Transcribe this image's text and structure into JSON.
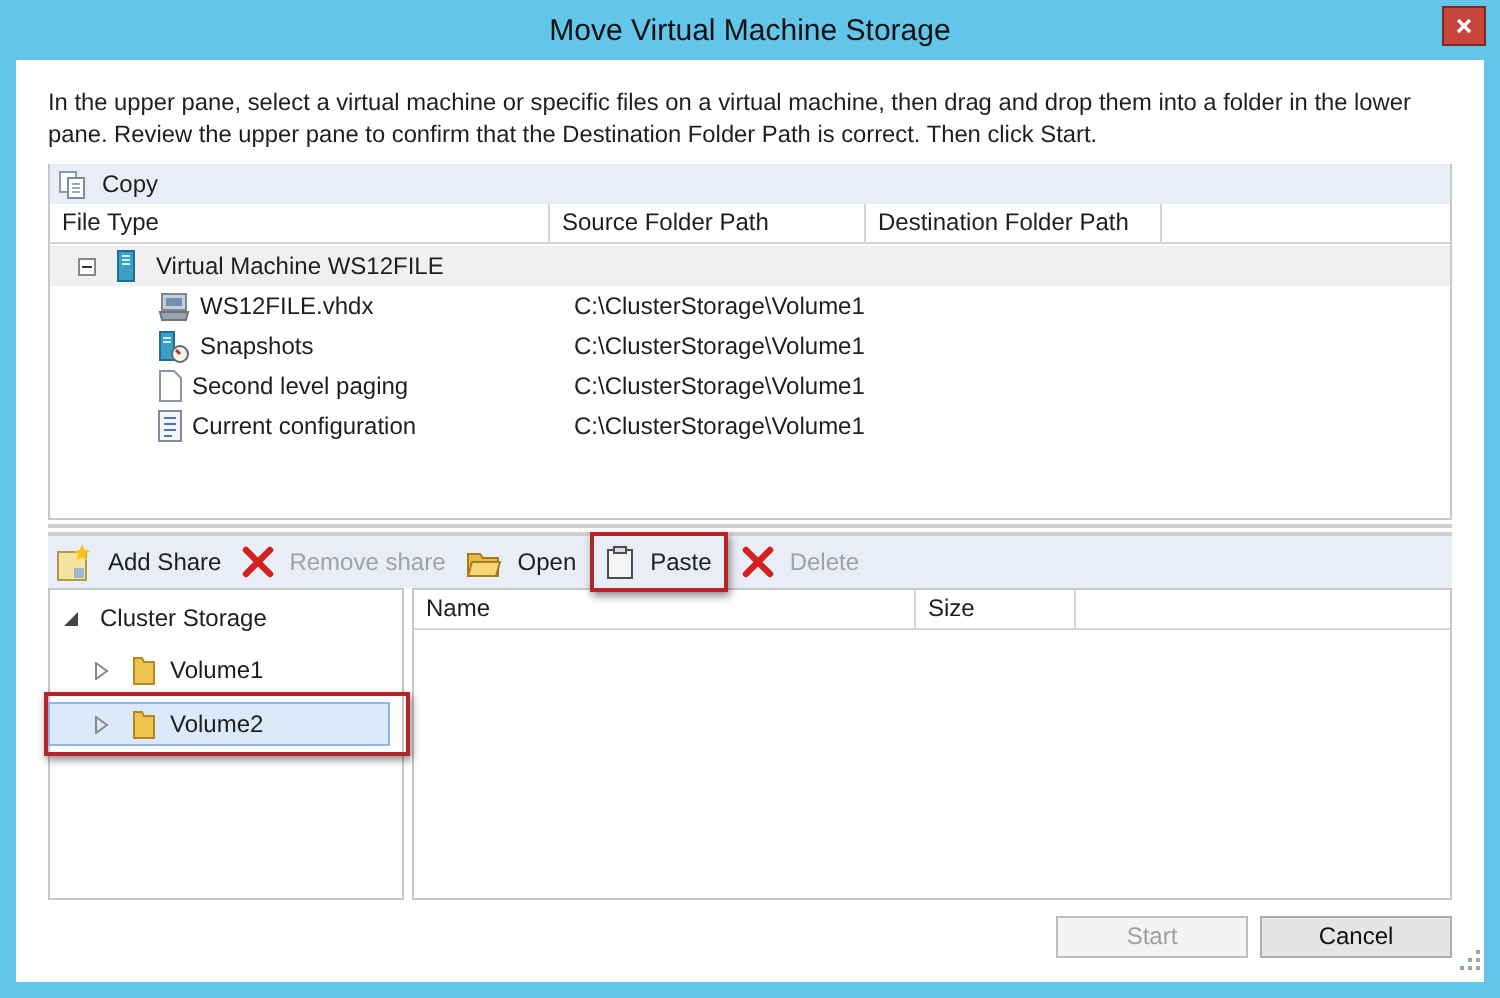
{
  "window": {
    "title": "Move Virtual Machine Storage"
  },
  "instructions": "In the upper pane, select a virtual machine or specific files on a virtual machine, then drag and drop them into a folder in the lower pane.  Review the upper pane to confirm that the Destination Folder Path is correct. Then click Start.",
  "upper_toolbar": [
    {
      "label": "Copy",
      "kind": "copy",
      "disabled": false
    }
  ],
  "upper_table": {
    "columns": [
      "File Type",
      "Source Folder Path",
      "Destination Folder Path"
    ],
    "rows": [
      {
        "name": "Virtual Machine WS12FILE",
        "kind": "vm",
        "expanded": true,
        "children": [
          {
            "name": "WS12FILE.vhdx",
            "kind": "disk",
            "source": "C:\\ClusterStorage\\Volume1"
          },
          {
            "name": "Snapshots",
            "kind": "snapshot",
            "source": "C:\\ClusterStorage\\Volume1"
          },
          {
            "name": "Second level paging",
            "kind": "file",
            "source": "C:\\ClusterStorage\\Volume1"
          },
          {
            "name": "Current configuration",
            "kind": "config",
            "source": "C:\\ClusterStorage\\Volume1"
          }
        ]
      }
    ]
  },
  "lower_toolbar": [
    {
      "label": "Add Share",
      "kind": "add",
      "disabled": false,
      "highlighted": false
    },
    {
      "label": "Remove share",
      "kind": "remove",
      "disabled": true,
      "highlighted": false
    },
    {
      "label": "Open",
      "kind": "open",
      "disabled": false,
      "highlighted": false
    },
    {
      "label": "Paste",
      "kind": "paste",
      "disabled": false,
      "highlighted": true
    },
    {
      "label": "Delete",
      "kind": "remove",
      "disabled": true,
      "highlighted": false
    }
  ],
  "folder_tree": [
    {
      "label": "Cluster Storage",
      "expanded": true,
      "selected": false,
      "highlighted": false,
      "children": [
        {
          "label": "Volume1",
          "expanded": false,
          "selected": false,
          "highlighted": false
        },
        {
          "label": "Volume2",
          "expanded": false,
          "selected": true,
          "highlighted": true
        }
      ]
    }
  ],
  "file_list": {
    "columns": [
      "Name",
      "Size"
    ]
  },
  "buttons": [
    {
      "label": "Start",
      "disabled": true
    },
    {
      "label": "Cancel",
      "disabled": false
    }
  ]
}
